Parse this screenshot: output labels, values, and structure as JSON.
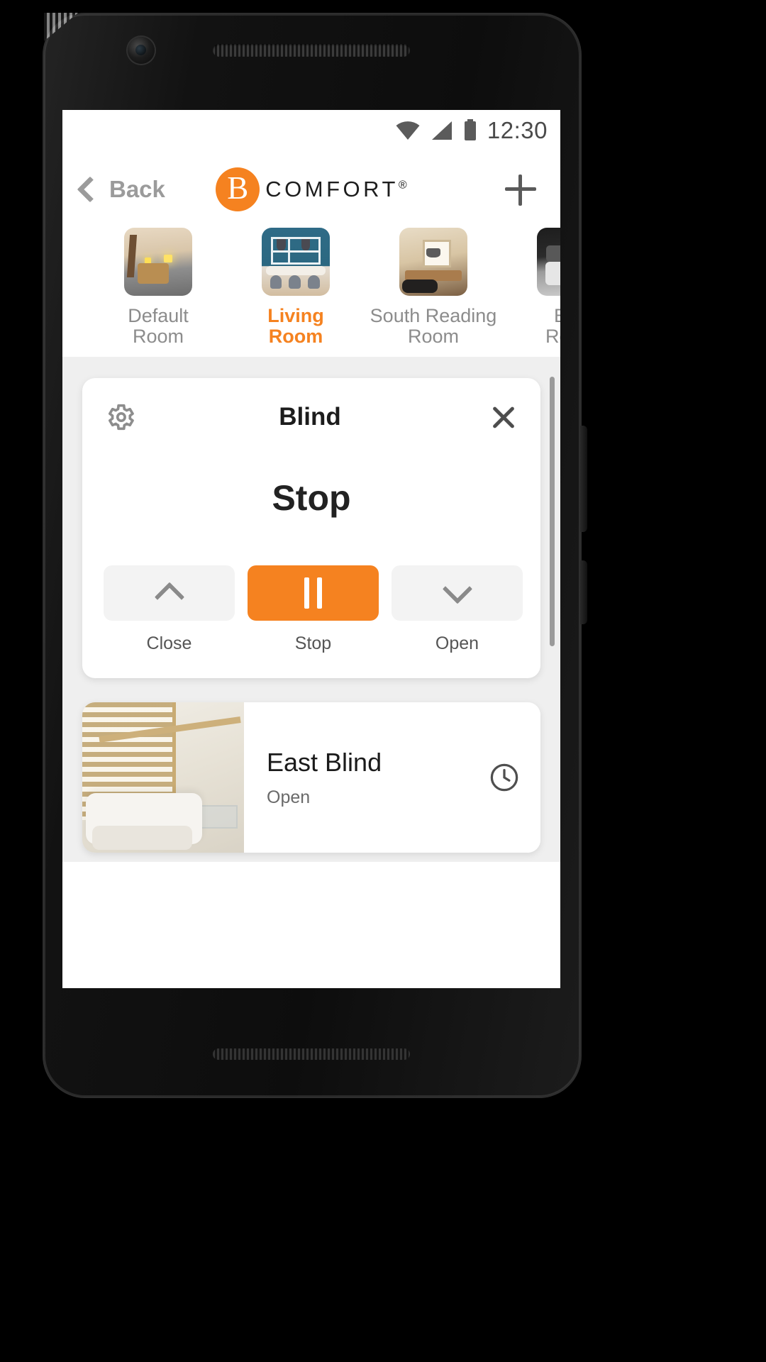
{
  "status_bar": {
    "time": "12:30",
    "icons": [
      "wifi-icon",
      "cellular-signal-icon",
      "battery-icon"
    ]
  },
  "header": {
    "back_label": "Back",
    "back_icon": "chevron-left-icon",
    "brand_letter": "B",
    "brand_word": "COMFORT",
    "brand_registered": "®",
    "add_icon": "plus-icon"
  },
  "rooms": {
    "items": [
      {
        "label_line1": "Default",
        "label_line2": "Room",
        "active": false
      },
      {
        "label_line1": "Living",
        "label_line2": "Room",
        "active": true
      },
      {
        "label_line1": "South Reading",
        "label_line2": "Room",
        "active": false
      },
      {
        "label_line1": "Bed",
        "label_line2": "Room",
        "active": false
      }
    ]
  },
  "blind_card": {
    "settings_icon": "gear-icon",
    "title": "Blind",
    "close_icon": "close-icon",
    "state": "Stop",
    "controls": [
      {
        "label": "Close",
        "icon": "chevron-up-icon",
        "active": false
      },
      {
        "label": "Stop",
        "icon": "pause-icon",
        "active": true
      },
      {
        "label": "Open",
        "icon": "chevron-down-icon",
        "active": false
      }
    ]
  },
  "devices": [
    {
      "name": "East Blind",
      "status": "Open",
      "action_icon": "clock-icon"
    }
  ],
  "colors": {
    "accent": "#F58220",
    "page_background": "#EFEFEF",
    "card": "#FFFFFF",
    "muted_text": "#8C8C8C"
  }
}
